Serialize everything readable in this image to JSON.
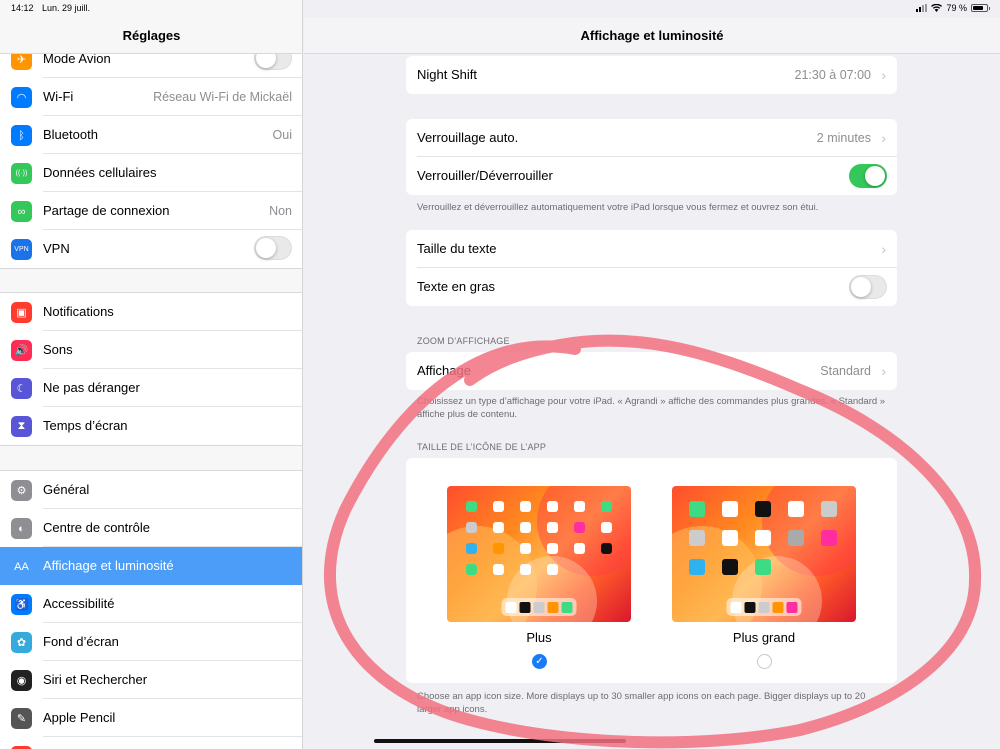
{
  "status": {
    "time": "14:12",
    "date": "Lun. 29 juill.",
    "battery": "79 %"
  },
  "sidebar": {
    "title": "Réglages",
    "group1": [
      {
        "label": "Mode Avion",
        "value": "",
        "toggle": "off",
        "icon": "airplane-icon",
        "color": "#ff9500",
        "glyph": "✈"
      },
      {
        "label": "Wi-Fi",
        "value": "Réseau Wi-Fi de Mickaël",
        "icon": "wifi-icon",
        "color": "#007aff",
        "glyph": "◠"
      },
      {
        "label": "Bluetooth",
        "value": "Oui",
        "icon": "bluetooth-icon",
        "color": "#007aff",
        "glyph": "ᛒ"
      },
      {
        "label": "Données cellulaires",
        "value": "",
        "icon": "cellular-icon",
        "color": "#34c759",
        "glyph": "((·))"
      },
      {
        "label": "Partage de connexion",
        "value": "Non",
        "icon": "hotspot-icon",
        "color": "#34c759",
        "glyph": "∞"
      },
      {
        "label": "VPN",
        "value": "",
        "toggle": "off",
        "icon": "vpn-icon",
        "color": "#1a73e8",
        "glyph": "VPN"
      }
    ],
    "group2": [
      {
        "label": "Notifications",
        "icon": "notifications-icon",
        "color": "#ff3b30",
        "glyph": "▣"
      },
      {
        "label": "Sons",
        "icon": "sounds-icon",
        "color": "#ff2d55",
        "glyph": "🔊"
      },
      {
        "label": "Ne pas déranger",
        "icon": "moon-icon",
        "color": "#5856d6",
        "glyph": "☾"
      },
      {
        "label": "Temps d’écran",
        "icon": "hourglass-icon",
        "color": "#5856d6",
        "glyph": "⧗"
      }
    ],
    "group3": [
      {
        "label": "Général",
        "icon": "gear-icon",
        "color": "#8e8e93",
        "glyph": "⚙"
      },
      {
        "label": "Centre de contrôle",
        "icon": "control-center-icon",
        "color": "#8e8e93",
        "glyph": "◐"
      },
      {
        "label": "Affichage et luminosité",
        "icon": "display-icon",
        "color": "#007aff",
        "glyph": "AA",
        "selected": true
      },
      {
        "label": "Accessibilité",
        "icon": "accessibility-icon",
        "color": "#007aff",
        "glyph": "♿"
      },
      {
        "label": "Fond d’écran",
        "icon": "wallpaper-icon",
        "color": "#35aadc",
        "glyph": "✿"
      },
      {
        "label": "Siri et Rechercher",
        "icon": "siri-icon",
        "color": "#222222",
        "glyph": "◉"
      },
      {
        "label": "Apple Pencil",
        "icon": "pencil-icon",
        "color": "#555555",
        "glyph": "✎"
      },
      {
        "label": "",
        "icon": "touchid-icon",
        "color": "#ff3b30",
        "glyph": ""
      }
    ]
  },
  "main": {
    "title": "Affichage et luminosité",
    "night_shift": {
      "label": "Night Shift",
      "value": "21:30 à 07:00"
    },
    "auto_lock": {
      "label": "Verrouillage auto.",
      "value": "2 minutes"
    },
    "lock_unlock": {
      "label": "Verrouiller/Déverrouiller",
      "toggle": "on"
    },
    "lock_note": "Verrouillez et déverrouillez automatiquement votre iPad lorsque vous fermez et ouvrez son étui.",
    "text_size": {
      "label": "Taille du texte"
    },
    "bold_text": {
      "label": "Texte en gras",
      "toggle": "off"
    },
    "zoom_header": "ZOOM D’AFFICHAGE",
    "display_zoom": {
      "label": "Affichage",
      "value": "Standard"
    },
    "zoom_note": "Choisissez un type d’affichage pour votre iPad. « Agrandi » affiche des commandes plus grandes. « Standard » affiche plus de contenu.",
    "icon_header": "TAILLE DE L’ICÔNE DE L’APP",
    "option_more": "Plus",
    "option_bigger": "Plus grand",
    "selected_option": "Plus",
    "icon_note": "Choose an app icon size. More displays up to 30 smaller app icons on each page. Bigger displays up to 20 larger app icons."
  },
  "colors": {
    "accent": "#4b9df7",
    "toggle_on": "#34c759",
    "annotation": "#f2707f"
  }
}
